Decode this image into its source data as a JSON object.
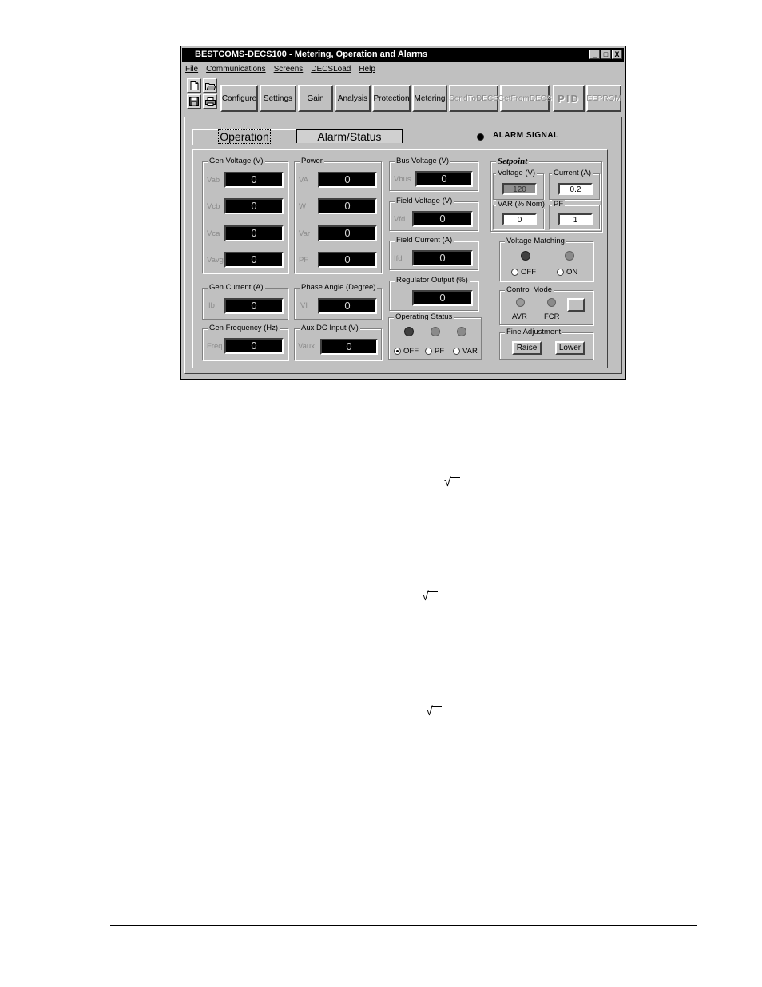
{
  "window": {
    "title": "BESTCOMS-DECS100 - Metering, Operation and Alarms",
    "controls": [
      "_",
      "□",
      "X"
    ]
  },
  "menu": [
    "File",
    "Communications",
    "Screens",
    "DECSLoad",
    "Help"
  ],
  "toolbar": {
    "icons": [
      "new-file-icon",
      "open-folder-icon",
      "save-disk-icon",
      "printer-icon"
    ],
    "buttons": [
      {
        "label": "Configure",
        "enabled": true
      },
      {
        "label": "Settings",
        "enabled": true
      },
      {
        "label": "Gain",
        "enabled": true
      },
      {
        "label": "Analysis",
        "enabled": true
      },
      {
        "label": "Protection",
        "enabled": true
      },
      {
        "label": "Metering",
        "enabled": true
      },
      {
        "label": "SendToDECS",
        "enabled": false
      },
      {
        "label": "GetFromDECS",
        "enabled": false
      },
      {
        "label": "PID",
        "enabled": false
      },
      {
        "label": "EEPROM",
        "enabled": false
      }
    ]
  },
  "tabs": {
    "operation": "Operation",
    "alarm_status": "Alarm/Status"
  },
  "alarm_signal": "ALARM SIGNAL",
  "gen_voltage": {
    "title": "Gen Voltage (V)",
    "rows": [
      {
        "label": "Vab",
        "value": "0"
      },
      {
        "label": "Vcb",
        "value": "0"
      },
      {
        "label": "Vca",
        "value": "0"
      },
      {
        "label": "Vavg",
        "value": "0"
      }
    ]
  },
  "power": {
    "title": "Power",
    "rows": [
      {
        "label": "VA",
        "value": "0"
      },
      {
        "label": "W",
        "value": "0"
      },
      {
        "label": "Var",
        "value": "0"
      },
      {
        "label": "PF",
        "value": "0"
      }
    ]
  },
  "gen_current": {
    "title": "Gen Current (A)",
    "label": "Ib",
    "value": "0"
  },
  "phase_angle": {
    "title": "Phase Angle (Degree)",
    "label": "VI",
    "value": "0"
  },
  "gen_frequency": {
    "title": "Gen Frequency (Hz)",
    "label": "Freq",
    "value": "0"
  },
  "aux_dc": {
    "title": "Aux DC Input (V)",
    "label": "Vaux",
    "value": "0"
  },
  "bus_voltage": {
    "title": "Bus Voltage (V)",
    "label": "Vbus",
    "value": "0"
  },
  "field_voltage": {
    "title": "Field Voltage (V)",
    "label": "Vfd",
    "value": "0"
  },
  "field_current": {
    "title": "Field Current (A)",
    "label": "Ifd",
    "value": "0"
  },
  "regulator_output": {
    "title": "Regulator Output (%)",
    "value": "0"
  },
  "operating_status": {
    "title": "Operating Status",
    "options": [
      "OFF",
      "PF",
      "VAR"
    ],
    "selected": "OFF"
  },
  "setpoint": {
    "title": "Setpoint",
    "voltage": {
      "title": "Voltage (V)",
      "value": "120"
    },
    "current": {
      "title": "Current (A)",
      "value": "0.2"
    },
    "var": {
      "title": "VAR (% Nom)",
      "value": "0"
    },
    "pf": {
      "title": "PF",
      "value": "1"
    }
  },
  "voltage_matching": {
    "title": "Voltage Matching",
    "off": "OFF",
    "on": "ON"
  },
  "control_mode": {
    "title": "Control Mode",
    "avr": "AVR",
    "fcr": "FCR"
  },
  "fine_adjustment": {
    "title": "Fine Adjustment",
    "raise": "Raise",
    "lower": "Lower"
  },
  "colors": {
    "lcd_bg": "#000000",
    "window_bg": "#c0c0c0",
    "titlebar": "#000000"
  }
}
